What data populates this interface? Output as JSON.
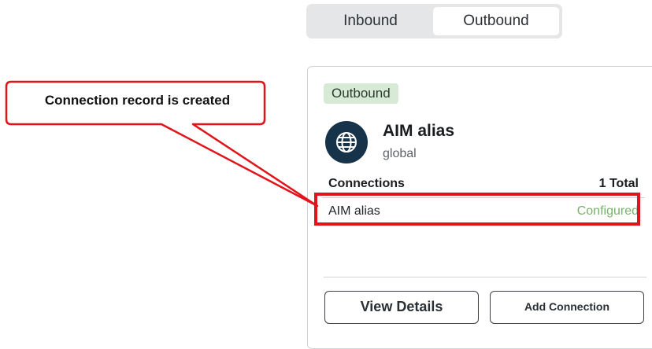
{
  "tabs": {
    "inbound_label": "Inbound",
    "outbound_label": "Outbound",
    "selected": "Outbound"
  },
  "card": {
    "badge": "Outbound",
    "icon": "globe-icon",
    "title": "AIM alias",
    "subtitle": "global",
    "connections_label": "Connections",
    "connections_total": "1 Total",
    "rows": [
      {
        "name": "AIM alias",
        "status": "Configured"
      }
    ],
    "view_details_label": "View Details",
    "add_connection_label": "Add Connection"
  },
  "annotation": {
    "text": "Connection record is created",
    "color": "#e0141b"
  },
  "colors": {
    "badge_bg": "#d6ead6",
    "icon_bg": "#17334a",
    "status_configured": "#79b26a"
  }
}
